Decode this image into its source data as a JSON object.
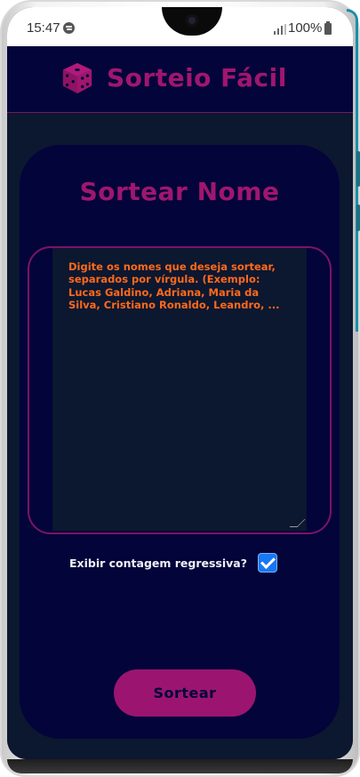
{
  "status_bar": {
    "time": "15:47",
    "battery_text": "100%",
    "icons": [
      "spotify-icon",
      "signal-icon",
      "battery-icon"
    ]
  },
  "header": {
    "icon": "dice-icon",
    "title": "Sorteio Fácil"
  },
  "card": {
    "title": "Sortear Nome",
    "names_placeholder": "Digite os nomes que deseja sortear, separados por vírgula. (Exemplo: Lucas Galdino, Adriana, Maria da Silva, Cristiano Ronaldo, Leandro, ...",
    "countdown_label": "Exibir contagem regressiva?",
    "countdown_checked": true,
    "draw_button_label": "Sortear"
  },
  "colors": {
    "background": "#02043a",
    "accent": "#a0166f",
    "placeholder": "#ff6a1a",
    "panel": "#0c1730",
    "checkbox": "#1877f2"
  }
}
